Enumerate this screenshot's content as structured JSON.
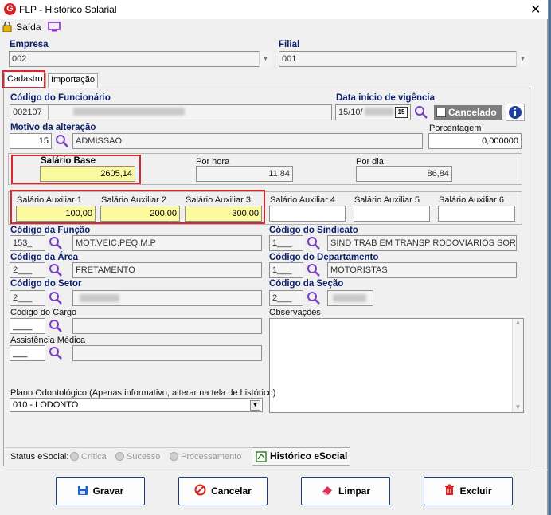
{
  "window": {
    "title": "FLP - Histórico Salarial",
    "logo": "G"
  },
  "toolbar": {
    "exit_label": "Saída"
  },
  "empresa": {
    "label": "Empresa",
    "value": "002"
  },
  "filial": {
    "label": "Filial",
    "value": "001"
  },
  "tabs": [
    {
      "label": "Cadastro"
    },
    {
      "label": "Importação"
    }
  ],
  "funcionario": {
    "label": "Código do Funcionário",
    "code": "002107"
  },
  "vigencia": {
    "label": "Data início de vigência",
    "value": "15/10/",
    "calendar": "15"
  },
  "cancelado": {
    "label": "Cancelado"
  },
  "motivo": {
    "label": "Motivo da alteração",
    "code": "15",
    "desc": "ADMISSAO"
  },
  "porcentagem": {
    "label": "Porcentagem",
    "value": "0,000000"
  },
  "salario_base": {
    "label": "Salário Base",
    "value": "2605,14"
  },
  "por_hora": {
    "label": "Por hora",
    "value": "11,84"
  },
  "por_dia": {
    "label": "Por dia",
    "value": "86,84"
  },
  "aux": [
    {
      "label": "Salário Auxiliar 1",
      "value": "100,00"
    },
    {
      "label": "Salário Auxiliar 2",
      "value": "200,00"
    },
    {
      "label": "Salário Auxiliar 3",
      "value": "300,00"
    },
    {
      "label": "Salário Auxiliar 4",
      "value": ""
    },
    {
      "label": "Salário Auxiliar 5",
      "value": ""
    },
    {
      "label": "Salário Auxiliar 6",
      "value": ""
    }
  ],
  "funcao": {
    "label": "Código da Função",
    "code": "153_",
    "desc": "MOT.VEIC.PEQ.M.P"
  },
  "sindicato": {
    "label": "Código do Sindicato",
    "code": "1___",
    "desc": "SIND TRAB EM TRANSP RODOVIARIOS SORO"
  },
  "area": {
    "label": "Código da Área",
    "code": "2___",
    "desc": "FRETAMENTO"
  },
  "departamento": {
    "label": "Código do Departamento",
    "code": "1___",
    "desc": "MOTORISTAS"
  },
  "setor": {
    "label": "Código do Setor",
    "code": "2___"
  },
  "secao": {
    "label": "Código da Seção",
    "code": "2___"
  },
  "cargo": {
    "label": "Código do Cargo",
    "code": "____"
  },
  "observacoes": {
    "label": "Observações"
  },
  "assistencia": {
    "label": "Assistência Médica",
    "code": "___"
  },
  "plano": {
    "label": "Plano Odontológico (Apenas informativo, alterar na tela de histórico)",
    "value": "010 - LODONTO"
  },
  "status": {
    "label": "Status eSocial:",
    "options": [
      "Crítica",
      "Sucesso",
      "Processamento"
    ],
    "historico_label": "Histórico eSocial"
  },
  "buttons": {
    "save": "Gravar",
    "cancel": "Cancelar",
    "clear": "Limpar",
    "delete": "Excluir"
  },
  "colors": {
    "label_blue": "#0a1f6b",
    "highlight_yellow": "#fbfa9e",
    "annotation_red": "#d9282d",
    "search_purple": "#7a3fc0"
  }
}
